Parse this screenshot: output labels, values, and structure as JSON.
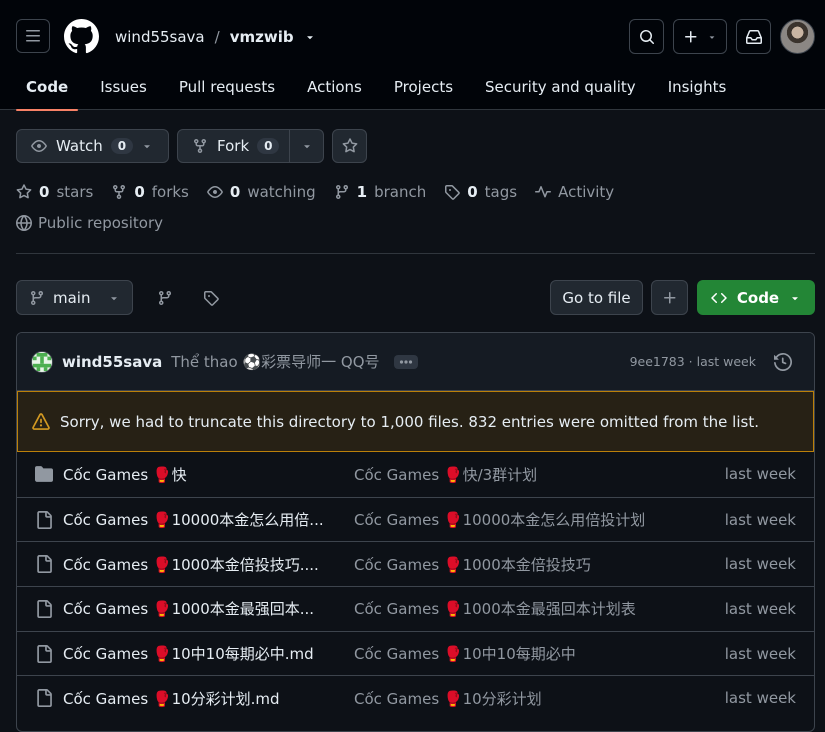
{
  "header": {
    "owner": "wind55sava",
    "separator": "/",
    "repo": "vmzwib"
  },
  "tabs": [
    {
      "label": "Code"
    },
    {
      "label": "Issues"
    },
    {
      "label": "Pull requests"
    },
    {
      "label": "Actions"
    },
    {
      "label": "Projects"
    },
    {
      "label": "Security and quality"
    },
    {
      "label": "Insights"
    }
  ],
  "actions": {
    "watch_label": "Watch",
    "watch_count": "0",
    "fork_label": "Fork",
    "fork_count": "0"
  },
  "stats": {
    "stars_n": "0",
    "stars": "stars",
    "forks_n": "0",
    "forks": "forks",
    "watching_n": "0",
    "watching": "watching",
    "branch_n": "1",
    "branch": "branch",
    "tags_n": "0",
    "tags": "tags",
    "activity": "Activity",
    "visibility": "Public repository"
  },
  "toolbar": {
    "branch": "main",
    "goto_file": "Go to file",
    "code": "Code"
  },
  "commit": {
    "author": "wind55sava",
    "message": "Thể thao ⚽彩票导师一 QQ号",
    "sha_time": "9ee1783 · last week"
  },
  "warning": "Sorry, we had to truncate this directory to 1,000 files. 832 entries were omitted from the list.",
  "files": [
    {
      "type": "folder",
      "name": "Cốc Games 🥊快",
      "message": "Cốc Games 🥊快/3群计划",
      "age": "last week"
    },
    {
      "type": "file",
      "name": "Cốc Games 🥊10000本金怎么用倍...",
      "message": "Cốc Games 🥊10000本金怎么用倍投计划",
      "age": "last week"
    },
    {
      "type": "file",
      "name": "Cốc Games 🥊1000本金倍投技巧....",
      "message": "Cốc Games 🥊1000本金倍投技巧",
      "age": "last week"
    },
    {
      "type": "file",
      "name": "Cốc Games 🥊1000本金最强回本...",
      "message": "Cốc Games 🥊1000本金最强回本计划表",
      "age": "last week"
    },
    {
      "type": "file",
      "name": "Cốc Games 🥊10中10每期必中.md",
      "message": "Cốc Games 🥊10中10每期必中",
      "age": "last week"
    },
    {
      "type": "file",
      "name": "Cốc Games 🥊10分彩计划.md",
      "message": "Cốc Games 🥊10分彩计划",
      "age": "last week"
    }
  ],
  "colors": {
    "accent": "#f78166",
    "code_button": "#238636",
    "warning_border": "#bb8009"
  }
}
